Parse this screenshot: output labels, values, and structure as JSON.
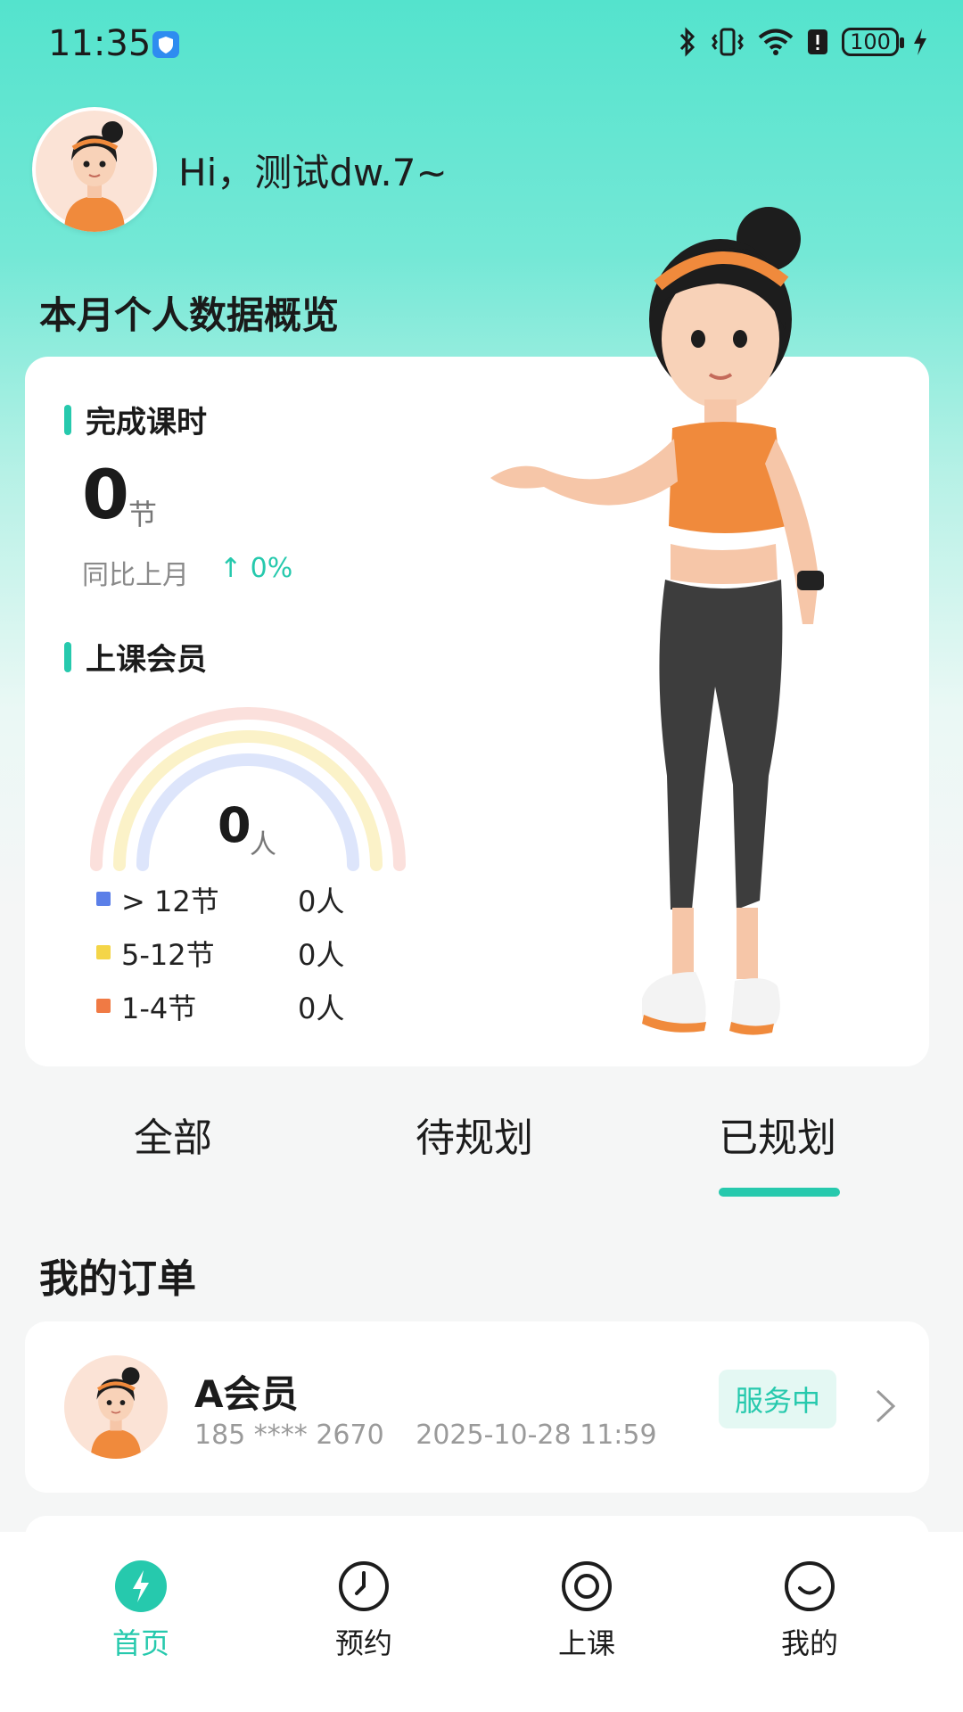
{
  "status_bar": {
    "time": "11:35",
    "battery": "100"
  },
  "header": {
    "greeting": "Hi，测试dw.7~"
  },
  "overview": {
    "title": "本月个人数据概览",
    "completed": {
      "label": "完成课时",
      "value": "0",
      "unit": "节",
      "compare_label": "同比上月",
      "compare_value": "↑ 0%"
    },
    "members": {
      "label": "上课会员",
      "value": "0",
      "unit": "人",
      "legend": [
        {
          "label": "> 12节",
          "value": "0人",
          "color": "#5b7fe8"
        },
        {
          "label": "5-12节",
          "value": "0人",
          "color": "#f4d548"
        },
        {
          "label": "1-4节",
          "value": "0人",
          "color": "#f07a44"
        }
      ]
    }
  },
  "tabs": [
    {
      "label": "全部",
      "active": false
    },
    {
      "label": "待规划",
      "active": false
    },
    {
      "label": "已规划",
      "active": true
    }
  ],
  "orders": {
    "title": "我的订单",
    "items": [
      {
        "name": "A会员",
        "phone": "185 **** 2670",
        "time": "2025-10-28 11:59",
        "status": "服务中"
      }
    ]
  },
  "nav": [
    {
      "label": "首页",
      "icon": "bolt-icon",
      "active": true
    },
    {
      "label": "预约",
      "icon": "clock-icon",
      "active": false
    },
    {
      "label": "上课",
      "icon": "target-icon",
      "active": false
    },
    {
      "label": "我的",
      "icon": "smile-icon",
      "active": false
    }
  ],
  "colors": {
    "accent": "#26c9ad",
    "accent_bg": "#e4f8f3"
  }
}
